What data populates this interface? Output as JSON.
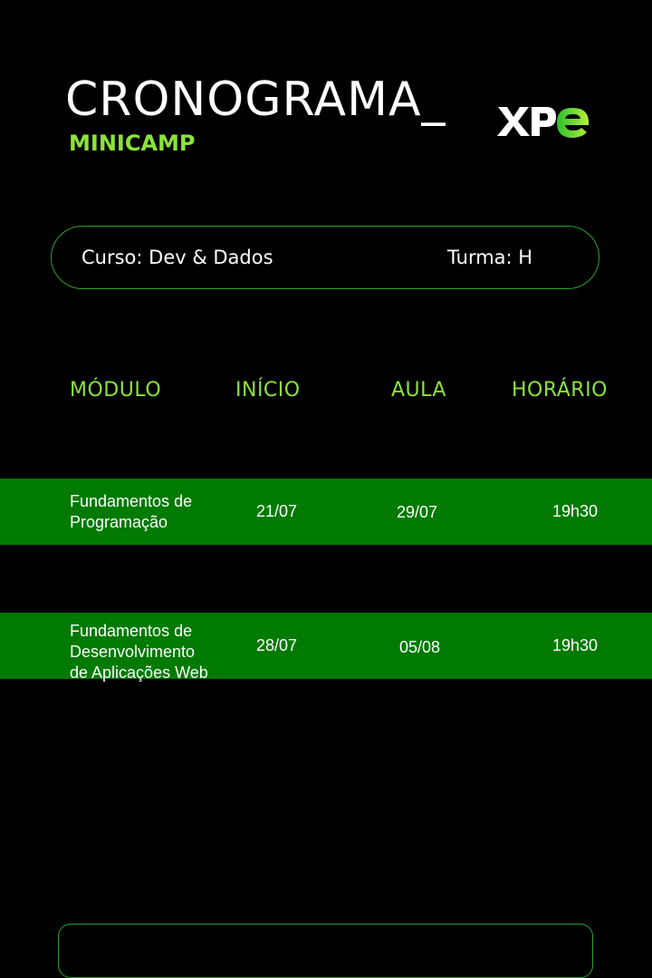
{
  "header": {
    "title": "CRONOGRAMA_",
    "subtitle": "MINICAMP",
    "logo_text": "XPe",
    "accent_color": "#8be33a",
    "row_color": "#007a00"
  },
  "info": {
    "course": "Curso: Dev & Dados",
    "class": "Turma: H"
  },
  "table": {
    "headers": [
      "MÓDULO",
      "INÍCIO",
      "AULA",
      "HORÁRIO"
    ],
    "rows": [
      {
        "modulo": "Fundamentos de\nProgramação",
        "inicio": "21/07",
        "aula": "29/07",
        "horario": "19h30"
      },
      {
        "modulo": "Fundamentos de\nDesenvolvimento\nde Aplicações Web",
        "inicio": "28/07",
        "aula": "05/08",
        "horario": "19h30"
      }
    ]
  }
}
